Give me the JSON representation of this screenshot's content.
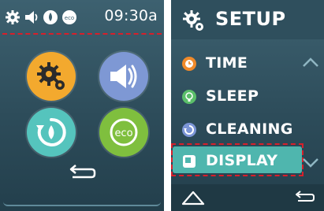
{
  "left_screen": {
    "status": {
      "time": "09:30a",
      "icons": [
        "gear-icon",
        "speaker-icon",
        "water-drop-icon",
        "eco-icon"
      ]
    },
    "buttons": [
      {
        "icon": "gear-icon",
        "color": "#f3a92e"
      },
      {
        "icon": "speaker-icon",
        "color": "#7e98d4"
      },
      {
        "icon": "cycle-water-icon",
        "color": "#55c4bd"
      },
      {
        "icon": "eco-icon",
        "color": "#7fbf3e"
      }
    ],
    "back_icon": "back-arrow-icon",
    "eco_text": "eco"
  },
  "right_screen": {
    "title": "SETUP",
    "menu": [
      {
        "label": "TIME",
        "icon": "clock-icon",
        "color": "#f08a2a"
      },
      {
        "label": "SLEEP",
        "icon": "bulb-icon",
        "color": "#5bbf6a"
      },
      {
        "label": "CLEANING",
        "icon": "cycle-icon",
        "color": "#7b95d6"
      },
      {
        "label": "DISPLAY",
        "icon": "display-icon",
        "color": "#ffffff",
        "selected": true
      }
    ],
    "nav": {
      "home_icon": "home-icon",
      "back_icon": "back-arrow-icon"
    }
  },
  "colors": {
    "screen_bg": "#2d4c5a",
    "highlight": "#4fb6ae",
    "dashed_marker": "#d81f2a"
  }
}
